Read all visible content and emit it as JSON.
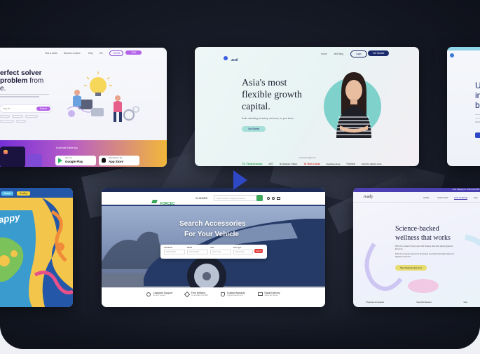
{
  "card_puzzle": {
    "nav": [
      "Find a solver",
      "Become a solver",
      "Help",
      "EN",
      "LOGIN",
      "JOIN"
    ],
    "headline_1": "erfect solver",
    "headline_2a": "problem",
    "headline_2b": " from",
    "headline_3": "e.",
    "search_placeholder": "ving for",
    "search_button": "Search",
    "download_label": "Download Mobile App",
    "google_small": "Get it on",
    "google_label": "Google Play",
    "apple_small": "Download on the",
    "apple_label": "App Store"
  },
  "card_jenfi": {
    "logo": "Jenfi",
    "nav": [
      "Home",
      "Jenfi Blog"
    ],
    "login": "Login",
    "get_started": "Get Started",
    "headline_1": "Asia's most",
    "headline_2": "flexible growth",
    "headline_3": "capital.",
    "subtext": "Scale marketing, inventory, and more, on your terms",
    "cta": "Get Started",
    "featured_label": "AS FEATURED ON",
    "logos": [
      "TC TechCrunch",
      "e27",
      "BUSINESS TIMES",
      "TA Tech in Asia",
      "DealStreetAsia",
      "Forbes",
      "DIGITAL NEWS ASIA"
    ]
  },
  "card_right_top": {
    "heading_lines": [
      "U",
      "in",
      "b"
    ]
  },
  "card_snack": {
    "tags": [
      "Snack",
      "Healthy"
    ],
    "label": "appy"
  },
  "card_auto": {
    "logo": "FORCEC",
    "phone": "01-2345678",
    "search_placeholder": "Search product, category, brand etc",
    "headline_1": "Search Accessories",
    "headline_2": "For Your Vehicle",
    "fields": [
      "Car Brand",
      "Model",
      "Year",
      "Part Type"
    ],
    "field_placeholders": [
      "Select Brand",
      "Select Model",
      "Select Year",
      "Select Type"
    ],
    "search_button": "Search",
    "features": [
      {
        "title": "Customer Support",
        "sub": "Get 24/7 support"
      },
      {
        "title": "Free Delivery",
        "sub": "On all orders over $99"
      },
      {
        "title": "Trusted Warranty",
        "sub": "Original products only"
      },
      {
        "title": "Rapid Delivery",
        "sub": "Same day delivery"
      }
    ]
  },
  "card_ready": {
    "topbar": "Free shipping on orders over $50",
    "logo": "ready",
    "nav": [
      "HOME",
      "SHOP NOW",
      "OUR SCIENCE",
      "FAQ"
    ],
    "headline_1": "Science-backed",
    "headline_2": "wellness that works",
    "p1": "81% of our Aware® study users find bloating relief after taking Digestive Enzymes.",
    "p2": "81% of our guests experience decreased meal discomfort after taking our Digestive Enzymes.",
    "cta": "Shop Digestive Enzymes",
    "footer_items": [
      "Physician-formulated",
      "Scientific-Backed",
      "New"
    ]
  },
  "colors": {
    "primary_blue": "#2f48c6",
    "purple": "#8a4bd6",
    "jenfi_navy": "#1b2a6b",
    "auto_nav": "#2a3a73",
    "auto_green": "#3ea85a",
    "ready_yellow": "#e7dd6e",
    "ready_purple": "#7c5ce0",
    "stage_dark": "#181c28"
  }
}
